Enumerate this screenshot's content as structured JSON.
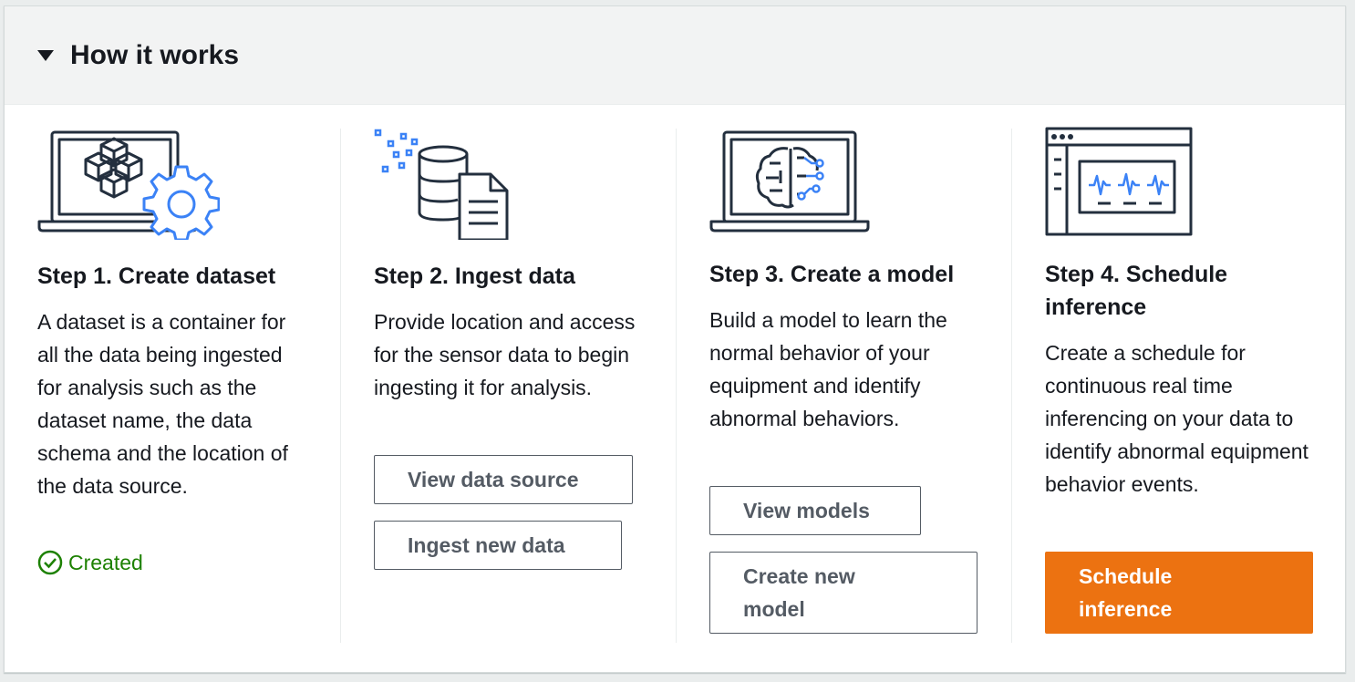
{
  "header": {
    "title": "How it works"
  },
  "steps": [
    {
      "title": "Step 1. Create dataset",
      "description": "A dataset is a container for all the data being ingested for analysis such as the dataset name, the data schema and the location of the data source.",
      "status": "Created",
      "icon": "laptop-cubes-gear-icon"
    },
    {
      "title": "Step 2. Ingest data",
      "description": "Provide location and access for the sensor data to begin ingesting it for analysis.",
      "buttons": [
        "View data source",
        "Ingest new data"
      ],
      "icon": "database-document-icon"
    },
    {
      "title": "Step 3. Create a model",
      "description": "Build a model to learn the normal behavior of your equipment and identify abnormal behaviors.",
      "buttons": [
        "View models",
        "Create new model"
      ],
      "icon": "laptop-brain-icon"
    },
    {
      "title": "Step 4. Schedule inference",
      "description": "Create a schedule for continuous real time inferencing on your data to identify abnormal equipment behavior events.",
      "buttons": [
        "Schedule inference"
      ],
      "icon": "monitor-waveform-icon"
    }
  ],
  "colors": {
    "primary": "#ec7211",
    "success": "#1d8102",
    "accent_blue": "#3b82f6",
    "text": "#16191f"
  }
}
